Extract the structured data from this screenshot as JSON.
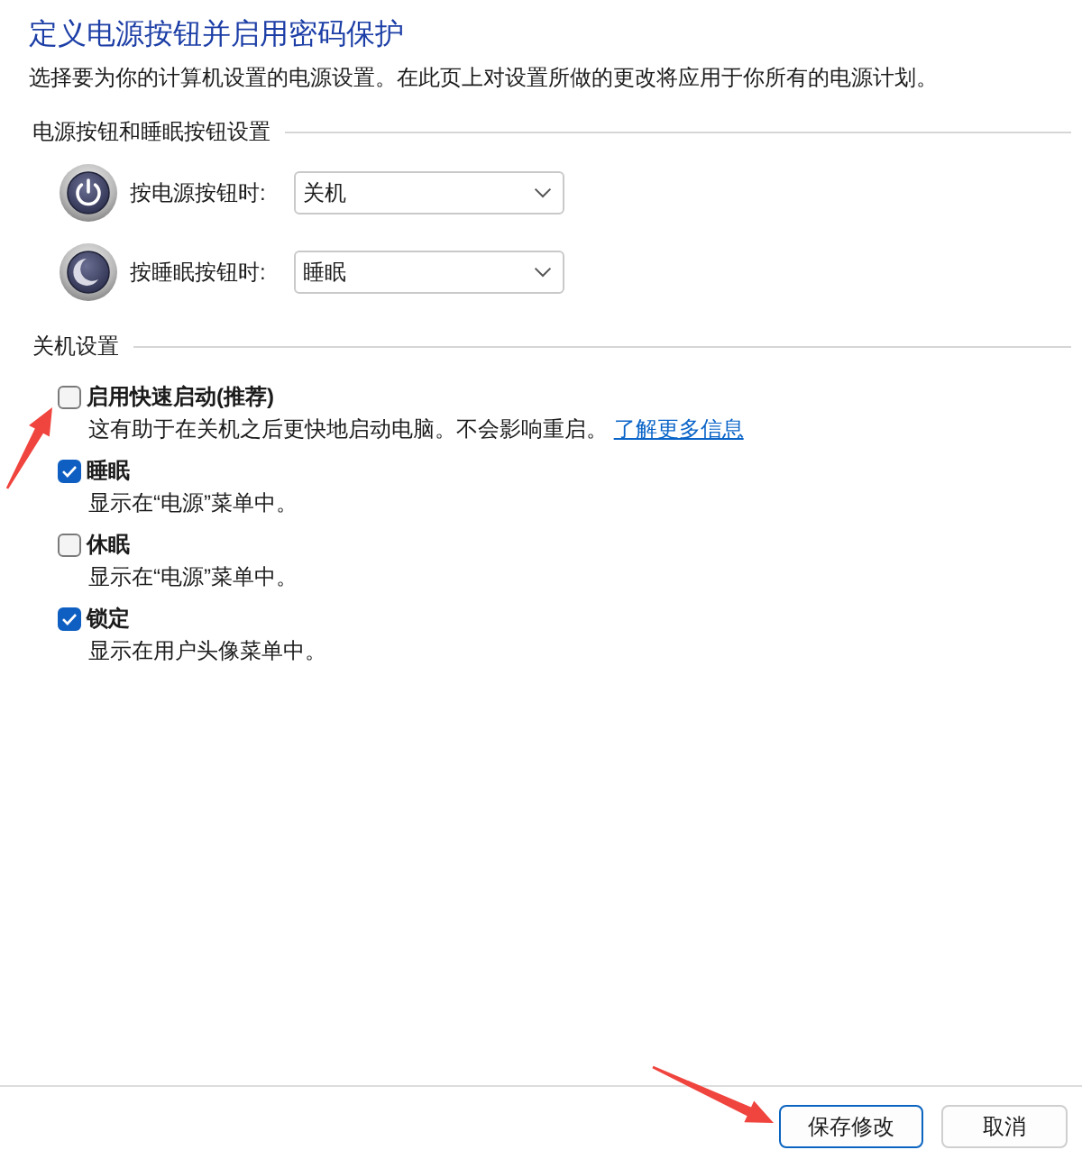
{
  "title": "定义电源按钮并启用密码保护",
  "description": "选择要为你的计算机设置的电源设置。在此页上对设置所做的更改将应用于你所有的电源计划。",
  "button_settings": {
    "heading": "电源按钮和睡眠按钮设置",
    "rows": [
      {
        "kind": "power",
        "label": "按电源按钮时:",
        "value": "关机"
      },
      {
        "kind": "sleep",
        "label": "按睡眠按钮时:",
        "value": "睡眠"
      }
    ]
  },
  "shutdown_settings": {
    "heading": "关机设置",
    "options": [
      {
        "label": "启用快速启动(推荐)",
        "checked": false,
        "description": "这有助于在关机之后更快地启动电脑。不会影响重启。",
        "link": "了解更多信息"
      },
      {
        "label": "睡眠",
        "checked": true,
        "description": "显示在“电源”菜单中。"
      },
      {
        "label": "休眠",
        "checked": false,
        "description": "显示在“电源”菜单中。"
      },
      {
        "label": "锁定",
        "checked": true,
        "description": "显示在用户头像菜单中。"
      }
    ]
  },
  "buttons": [
    {
      "label": "保存修改",
      "focused": true
    },
    {
      "label": "取消",
      "focused": false
    }
  ]
}
